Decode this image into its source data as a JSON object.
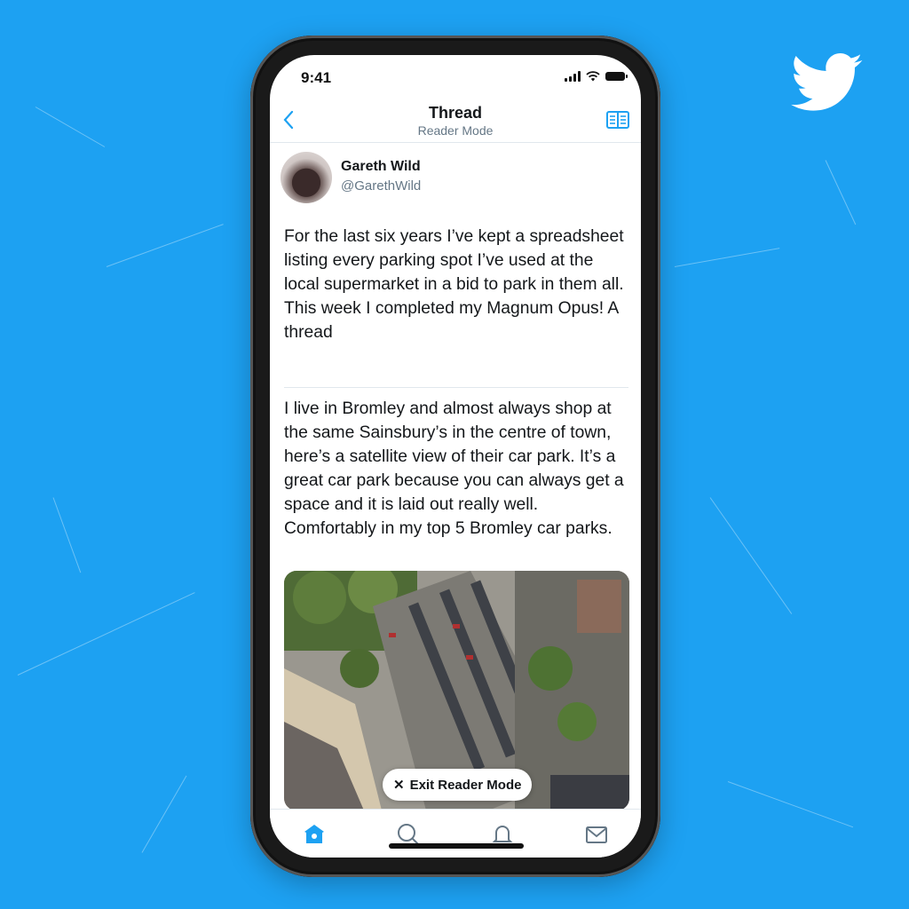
{
  "status_bar": {
    "time": "9:41",
    "icons": [
      "cellular-signal-icon",
      "wifi-icon",
      "battery-icon"
    ]
  },
  "nav": {
    "back_icon": "chevron-left-icon",
    "title": "Thread",
    "subtitle": "Reader Mode",
    "reader_icon": "open-book-icon"
  },
  "author": {
    "name": "Gareth Wild",
    "handle": "@GarethWild"
  },
  "tweets": [
    {
      "text": "For the last six years I’ve kept a spreadsheet listing every parking spot I’ve used at the local supermarket in a bid to park in them all. This week I completed my Magnum Opus! A thread"
    },
    {
      "text": "I live in Bromley and almost always shop at the same Sainsbury’s in the centre of town, here’s a satellite view of their car park. It’s a great car park because you can always get a space and it is laid out really well. Comfortably in my top 5 Bromley car parks.",
      "media": "satellite view of supermarket car park"
    }
  ],
  "exit_reader": {
    "icon": "close-icon",
    "label": "Exit Reader Mode"
  },
  "tabbar": {
    "items": [
      {
        "name": "home",
        "icon": "home-icon",
        "active": true
      },
      {
        "name": "search",
        "icon": "search-icon",
        "active": false
      },
      {
        "name": "notifications",
        "icon": "bell-icon",
        "active": false
      },
      {
        "name": "messages",
        "icon": "mail-icon",
        "active": false
      }
    ]
  },
  "brand": {
    "logo": "twitter-bird-icon",
    "accent": "#1da1f2",
    "text_color": "#14171a",
    "secondary_text": "#657786"
  }
}
